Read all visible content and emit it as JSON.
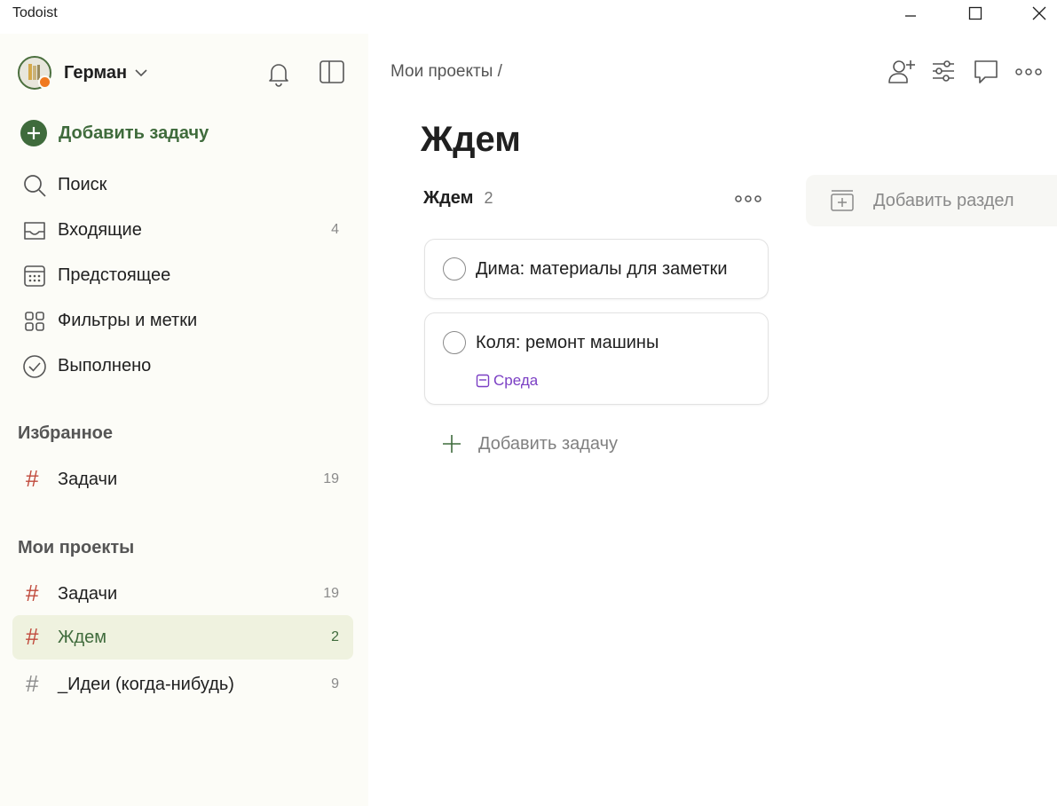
{
  "window": {
    "title": "Todoist"
  },
  "sidebar": {
    "user_name": "Герман",
    "add_task_label": "Добавить задачу",
    "nav": [
      {
        "label": "Поиск",
        "count": ""
      },
      {
        "label": "Входящие",
        "count": "4"
      },
      {
        "label": "Предстоящее",
        "count": ""
      },
      {
        "label": "Фильтры и метки",
        "count": ""
      },
      {
        "label": "Выполнено",
        "count": ""
      }
    ],
    "favorites_header": "Избранное",
    "favorites": [
      {
        "label": "Задачи",
        "count": "19"
      }
    ],
    "projects_header": "Мои проекты",
    "projects": [
      {
        "label": "Задачи",
        "count": "19"
      },
      {
        "label": "Ждем",
        "count": "2"
      },
      {
        "label": "_Идеи (когда-нибудь)",
        "count": "9"
      }
    ]
  },
  "main": {
    "breadcrumb": "Мои проекты /",
    "title": "Ждем",
    "section": {
      "name": "Ждем",
      "count": "2"
    },
    "tasks": [
      {
        "title": "Дима: материалы для заметки",
        "due": ""
      },
      {
        "title": "Коля: ремонт машины",
        "due": "Среда"
      }
    ],
    "add_task_label": "Добавить задачу",
    "add_section_label": "Добавить раздел"
  },
  "colors": {
    "accent_green": "#3f6b3c",
    "project_hash_red": "#c04a3c",
    "due_purple": "#7b3fc4",
    "notification_dot": "#f0791f",
    "active_item_bg": "#eff2df"
  }
}
